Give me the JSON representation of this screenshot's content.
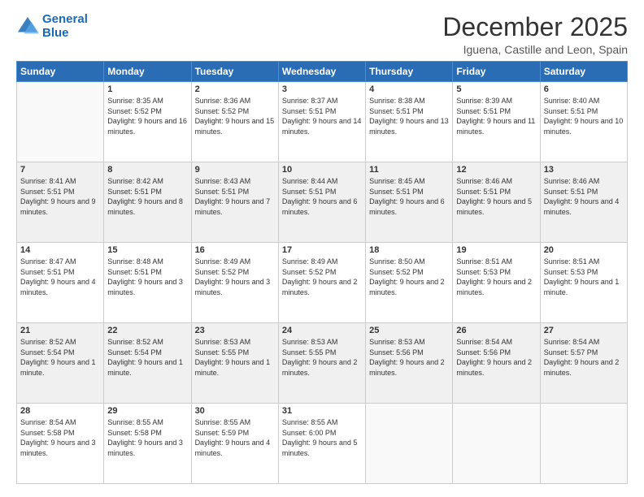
{
  "logo": {
    "line1": "General",
    "line2": "Blue"
  },
  "header": {
    "title": "December 2025",
    "location": "Iguena, Castille and Leon, Spain"
  },
  "weekdays": [
    "Sunday",
    "Monday",
    "Tuesday",
    "Wednesday",
    "Thursday",
    "Friday",
    "Saturday"
  ],
  "weeks": [
    [
      {
        "day": "",
        "sunrise": "",
        "sunset": "",
        "daylight": ""
      },
      {
        "day": "1",
        "sunrise": "Sunrise: 8:35 AM",
        "sunset": "Sunset: 5:52 PM",
        "daylight": "Daylight: 9 hours and 16 minutes."
      },
      {
        "day": "2",
        "sunrise": "Sunrise: 8:36 AM",
        "sunset": "Sunset: 5:52 PM",
        "daylight": "Daylight: 9 hours and 15 minutes."
      },
      {
        "day": "3",
        "sunrise": "Sunrise: 8:37 AM",
        "sunset": "Sunset: 5:51 PM",
        "daylight": "Daylight: 9 hours and 14 minutes."
      },
      {
        "day": "4",
        "sunrise": "Sunrise: 8:38 AM",
        "sunset": "Sunset: 5:51 PM",
        "daylight": "Daylight: 9 hours and 13 minutes."
      },
      {
        "day": "5",
        "sunrise": "Sunrise: 8:39 AM",
        "sunset": "Sunset: 5:51 PM",
        "daylight": "Daylight: 9 hours and 11 minutes."
      },
      {
        "day": "6",
        "sunrise": "Sunrise: 8:40 AM",
        "sunset": "Sunset: 5:51 PM",
        "daylight": "Daylight: 9 hours and 10 minutes."
      }
    ],
    [
      {
        "day": "7",
        "sunrise": "Sunrise: 8:41 AM",
        "sunset": "Sunset: 5:51 PM",
        "daylight": "Daylight: 9 hours and 9 minutes."
      },
      {
        "day": "8",
        "sunrise": "Sunrise: 8:42 AM",
        "sunset": "Sunset: 5:51 PM",
        "daylight": "Daylight: 9 hours and 8 minutes."
      },
      {
        "day": "9",
        "sunrise": "Sunrise: 8:43 AM",
        "sunset": "Sunset: 5:51 PM",
        "daylight": "Daylight: 9 hours and 7 minutes."
      },
      {
        "day": "10",
        "sunrise": "Sunrise: 8:44 AM",
        "sunset": "Sunset: 5:51 PM",
        "daylight": "Daylight: 9 hours and 6 minutes."
      },
      {
        "day": "11",
        "sunrise": "Sunrise: 8:45 AM",
        "sunset": "Sunset: 5:51 PM",
        "daylight": "Daylight: 9 hours and 6 minutes."
      },
      {
        "day": "12",
        "sunrise": "Sunrise: 8:46 AM",
        "sunset": "Sunset: 5:51 PM",
        "daylight": "Daylight: 9 hours and 5 minutes."
      },
      {
        "day": "13",
        "sunrise": "Sunrise: 8:46 AM",
        "sunset": "Sunset: 5:51 PM",
        "daylight": "Daylight: 9 hours and 4 minutes."
      }
    ],
    [
      {
        "day": "14",
        "sunrise": "Sunrise: 8:47 AM",
        "sunset": "Sunset: 5:51 PM",
        "daylight": "Daylight: 9 hours and 4 minutes."
      },
      {
        "day": "15",
        "sunrise": "Sunrise: 8:48 AM",
        "sunset": "Sunset: 5:51 PM",
        "daylight": "Daylight: 9 hours and 3 minutes."
      },
      {
        "day": "16",
        "sunrise": "Sunrise: 8:49 AM",
        "sunset": "Sunset: 5:52 PM",
        "daylight": "Daylight: 9 hours and 3 minutes."
      },
      {
        "day": "17",
        "sunrise": "Sunrise: 8:49 AM",
        "sunset": "Sunset: 5:52 PM",
        "daylight": "Daylight: 9 hours and 2 minutes."
      },
      {
        "day": "18",
        "sunrise": "Sunrise: 8:50 AM",
        "sunset": "Sunset: 5:52 PM",
        "daylight": "Daylight: 9 hours and 2 minutes."
      },
      {
        "day": "19",
        "sunrise": "Sunrise: 8:51 AM",
        "sunset": "Sunset: 5:53 PM",
        "daylight": "Daylight: 9 hours and 2 minutes."
      },
      {
        "day": "20",
        "sunrise": "Sunrise: 8:51 AM",
        "sunset": "Sunset: 5:53 PM",
        "daylight": "Daylight: 9 hours and 1 minute."
      }
    ],
    [
      {
        "day": "21",
        "sunrise": "Sunrise: 8:52 AM",
        "sunset": "Sunset: 5:54 PM",
        "daylight": "Daylight: 9 hours and 1 minute."
      },
      {
        "day": "22",
        "sunrise": "Sunrise: 8:52 AM",
        "sunset": "Sunset: 5:54 PM",
        "daylight": "Daylight: 9 hours and 1 minute."
      },
      {
        "day": "23",
        "sunrise": "Sunrise: 8:53 AM",
        "sunset": "Sunset: 5:55 PM",
        "daylight": "Daylight: 9 hours and 1 minute."
      },
      {
        "day": "24",
        "sunrise": "Sunrise: 8:53 AM",
        "sunset": "Sunset: 5:55 PM",
        "daylight": "Daylight: 9 hours and 2 minutes."
      },
      {
        "day": "25",
        "sunrise": "Sunrise: 8:53 AM",
        "sunset": "Sunset: 5:56 PM",
        "daylight": "Daylight: 9 hours and 2 minutes."
      },
      {
        "day": "26",
        "sunrise": "Sunrise: 8:54 AM",
        "sunset": "Sunset: 5:56 PM",
        "daylight": "Daylight: 9 hours and 2 minutes."
      },
      {
        "day": "27",
        "sunrise": "Sunrise: 8:54 AM",
        "sunset": "Sunset: 5:57 PM",
        "daylight": "Daylight: 9 hours and 2 minutes."
      }
    ],
    [
      {
        "day": "28",
        "sunrise": "Sunrise: 8:54 AM",
        "sunset": "Sunset: 5:58 PM",
        "daylight": "Daylight: 9 hours and 3 minutes."
      },
      {
        "day": "29",
        "sunrise": "Sunrise: 8:55 AM",
        "sunset": "Sunset: 5:58 PM",
        "daylight": "Daylight: 9 hours and 3 minutes."
      },
      {
        "day": "30",
        "sunrise": "Sunrise: 8:55 AM",
        "sunset": "Sunset: 5:59 PM",
        "daylight": "Daylight: 9 hours and 4 minutes."
      },
      {
        "day": "31",
        "sunrise": "Sunrise: 8:55 AM",
        "sunset": "Sunset: 6:00 PM",
        "daylight": "Daylight: 9 hours and 5 minutes."
      },
      {
        "day": "",
        "sunrise": "",
        "sunset": "",
        "daylight": ""
      },
      {
        "day": "",
        "sunrise": "",
        "sunset": "",
        "daylight": ""
      },
      {
        "day": "",
        "sunrise": "",
        "sunset": "",
        "daylight": ""
      }
    ]
  ]
}
